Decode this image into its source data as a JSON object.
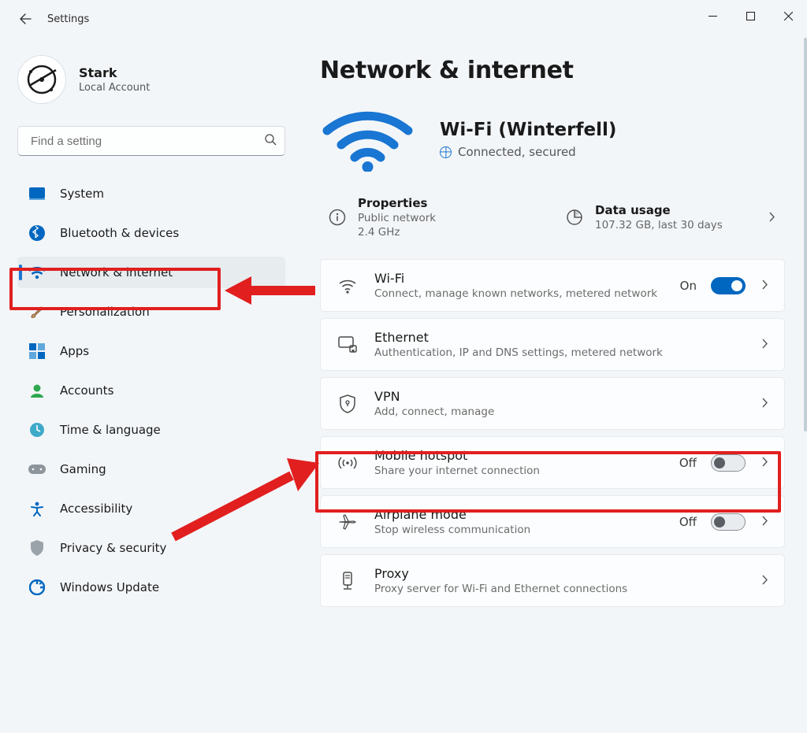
{
  "window": {
    "appTitle": "Settings"
  },
  "user": {
    "name": "Stark",
    "type": "Local Account"
  },
  "search": {
    "placeholder": "Find a setting"
  },
  "sidebar": {
    "items": [
      {
        "id": "system",
        "label": "System"
      },
      {
        "id": "bluetooth",
        "label": "Bluetooth & devices"
      },
      {
        "id": "network",
        "label": "Network & internet",
        "selected": true
      },
      {
        "id": "personalization",
        "label": "Personalization"
      },
      {
        "id": "apps",
        "label": "Apps"
      },
      {
        "id": "accounts",
        "label": "Accounts"
      },
      {
        "id": "time",
        "label": "Time & language"
      },
      {
        "id": "gaming",
        "label": "Gaming"
      },
      {
        "id": "accessibility",
        "label": "Accessibility"
      },
      {
        "id": "privacy",
        "label": "Privacy & security"
      },
      {
        "id": "update",
        "label": "Windows Update"
      }
    ]
  },
  "page": {
    "title": "Network & internet",
    "network": {
      "name": "Wi-Fi (Winterfell)",
      "status": "Connected, secured"
    },
    "properties": {
      "heading": "Properties",
      "line1": "Public network",
      "line2": "2.4 GHz"
    },
    "dataUsage": {
      "heading": "Data usage",
      "line1": "107.32 GB, last 30 days"
    },
    "cards": [
      {
        "id": "wifi",
        "title": "Wi-Fi",
        "sub": "Connect, manage known networks, metered network",
        "toggle": "On"
      },
      {
        "id": "ethernet",
        "title": "Ethernet",
        "sub": "Authentication, IP and DNS settings, metered network"
      },
      {
        "id": "vpn",
        "title": "VPN",
        "sub": "Add, connect, manage"
      },
      {
        "id": "hotspot",
        "title": "Mobile hotspot",
        "sub": "Share your internet connection",
        "toggle": "Off"
      },
      {
        "id": "airplane",
        "title": "Airplane mode",
        "sub": "Stop wireless communication",
        "toggle": "Off"
      },
      {
        "id": "proxy",
        "title": "Proxy",
        "sub": "Proxy server for Wi-Fi and Ethernet connections"
      }
    ]
  }
}
